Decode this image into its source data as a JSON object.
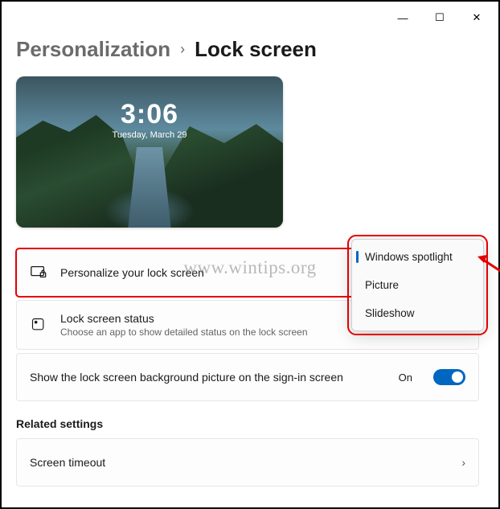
{
  "window": {
    "minimize": "—",
    "maximize": "☐",
    "close": "✕"
  },
  "breadcrumb": {
    "parent": "Personalization",
    "separator": "›",
    "current": "Lock screen"
  },
  "preview": {
    "time": "3:06",
    "date": "Tuesday, March 29"
  },
  "watermark": "www.wintips.org",
  "rows": {
    "personalize": {
      "title": "Personalize your lock screen"
    },
    "status": {
      "title": "Lock screen status",
      "subtitle": "Choose an app to show detailed status on the lock screen"
    },
    "signin_bg": {
      "title": "Show the lock screen background picture on the sign-in screen",
      "toggle_label": "On",
      "toggle_on": true
    }
  },
  "dropdown": {
    "options": [
      {
        "label": "Windows spotlight",
        "selected": true
      },
      {
        "label": "Picture",
        "selected": false
      },
      {
        "label": "Slideshow",
        "selected": false
      }
    ]
  },
  "related": {
    "heading": "Related settings",
    "items": [
      {
        "title": "Screen timeout"
      }
    ]
  }
}
